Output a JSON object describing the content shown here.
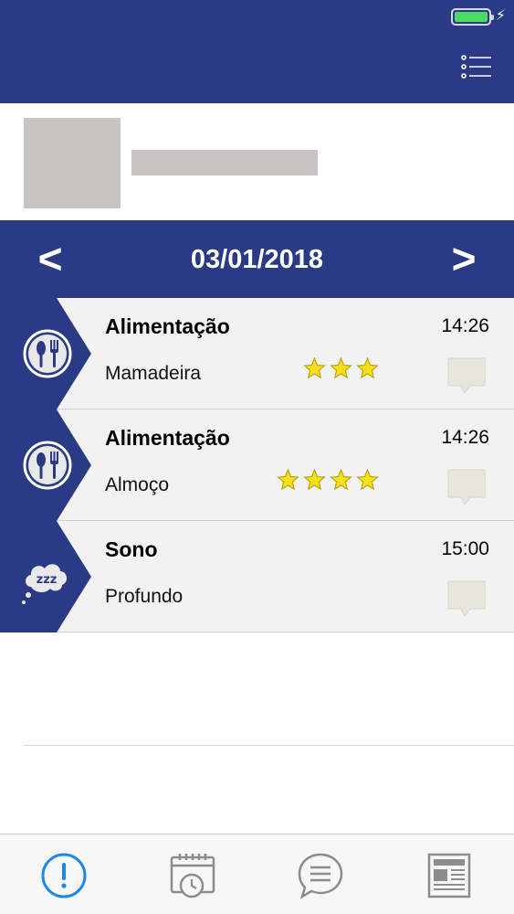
{
  "header": {
    "menu_icon": "list-menu-icon",
    "battery_icon": "battery-icon",
    "charging_icon": "charging-bolt-icon",
    "battery_color": "#4cd964",
    "bolt_glyph": "⚡"
  },
  "profile": {
    "avatar_icon": "avatar-placeholder",
    "name_placeholder": "name-placeholder"
  },
  "date_nav": {
    "prev_label": "<",
    "next_label": ">",
    "date": "03/01/2018"
  },
  "events": [
    {
      "icon": "fork-spoon-icon",
      "title": "Alimentação",
      "time": "14:26",
      "subtitle": "Mamadeira",
      "rating": 3
    },
    {
      "icon": "fork-spoon-icon",
      "title": "Alimentação",
      "time": "14:26",
      "subtitle": "Almoço",
      "rating": 4
    },
    {
      "icon": "sleep-cloud-icon",
      "title": "Sono",
      "time": "15:00",
      "subtitle": "Profundo",
      "rating": 0
    }
  ],
  "tabbar": {
    "tabs": [
      {
        "icon": "alert-circle-icon",
        "active": true
      },
      {
        "icon": "calendar-clock-icon",
        "active": false
      },
      {
        "icon": "chat-bubble-icon",
        "active": false
      },
      {
        "icon": "newspaper-icon",
        "active": false
      }
    ]
  },
  "colors": {
    "brand": "#2b3a85",
    "star": "#f4e01a",
    "active_tab": "#1e88e5",
    "inactive_tab": "#8c8c8c",
    "comment_bubble": "#e6e6dc"
  }
}
